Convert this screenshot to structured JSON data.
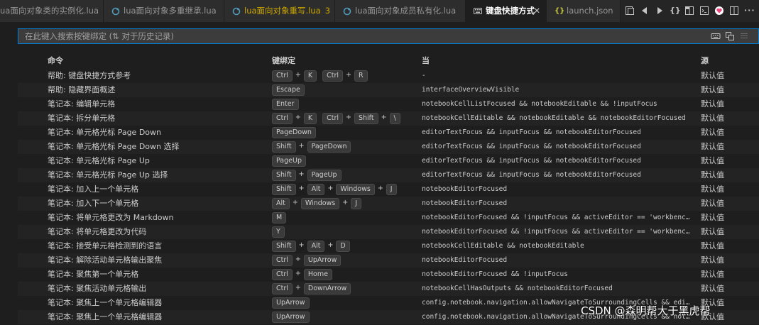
{
  "tabs": [
    {
      "label": "ua面向对象类的实例化.lua",
      "icon": "lua-file-icon",
      "state": "normal"
    },
    {
      "label": "lua面向对象多重继承.lua",
      "icon": "lua-file-icon",
      "state": "normal"
    },
    {
      "label": "lua面向对象重写.lua",
      "badge": "3",
      "icon": "lua-file-icon",
      "state": "modified"
    },
    {
      "label": "lua面向对象成员私有化.lua",
      "icon": "lua-file-icon",
      "state": "normal"
    },
    {
      "label": "键盘快捷方式",
      "icon": "keyboard-shortcuts-icon",
      "state": "active",
      "close": "✕"
    },
    {
      "label": "launch.json",
      "icon": "json-file-icon",
      "state": "normal"
    }
  ],
  "editor_actions": [
    "open-changes-icon",
    "go-back-icon",
    "go-forward-icon",
    "open-json-icon",
    "split-editor-icon",
    "terminal-icon",
    "extension-icon",
    "split-vertical-icon",
    "more-actions-icon"
  ],
  "search": {
    "placeholder": "在此键入搜索按键绑定 (⇅ 对于历史记录)",
    "icons": [
      "keyboard-record-icon",
      "sort-by-precedence-icon",
      "clear-filter-icon"
    ]
  },
  "table": {
    "headers": {
      "command": "命令",
      "keybinding": "键绑定",
      "when": "当",
      "source": "源"
    },
    "rows": [
      {
        "command": "帮助: 键盘快捷方式参考",
        "keys": [
          [
            "Ctrl",
            "K"
          ],
          [
            "Ctrl",
            "R"
          ]
        ],
        "when": "-",
        "source": "默认值"
      },
      {
        "command": "帮助: 隐藏界面概述",
        "keys": [
          [
            "Escape"
          ]
        ],
        "when": "interfaceOverviewVisible",
        "source": "默认值"
      },
      {
        "command": "笔记本: 编辑单元格",
        "keys": [
          [
            "Enter"
          ]
        ],
        "when": "notebookCellListFocused && notebookEditable && !inputFocus",
        "source": "默认值"
      },
      {
        "command": "笔记本: 拆分单元格",
        "keys": [
          [
            "Ctrl",
            "K"
          ],
          [
            "Ctrl",
            "Shift",
            "\\"
          ]
        ],
        "when": "notebookCellEditable && notebookEditable && notebookEditorFocused",
        "source": "默认值"
      },
      {
        "command": "笔记本: 单元格光标 Page Down",
        "keys": [
          [
            "PageDown"
          ]
        ],
        "when": "editorTextFocus && inputFocus && notebookEditorFocused",
        "source": "默认值"
      },
      {
        "command": "笔记本: 单元格光标 Page Down 选择",
        "keys": [
          [
            "Shift",
            "PageDown"
          ]
        ],
        "when": "editorTextFocus && inputFocus && notebookEditorFocused",
        "source": "默认值"
      },
      {
        "command": "笔记本: 单元格光标 Page Up",
        "keys": [
          [
            "PageUp"
          ]
        ],
        "when": "editorTextFocus && inputFocus && notebookEditorFocused",
        "source": "默认值"
      },
      {
        "command": "笔记本: 单元格光标 Page Up 选择",
        "keys": [
          [
            "Shift",
            "PageUp"
          ]
        ],
        "when": "editorTextFocus && inputFocus && notebookEditorFocused",
        "source": "默认值"
      },
      {
        "command": "笔记本: 加入上一个单元格",
        "keys": [
          [
            "Shift",
            "Alt",
            "Windows",
            "J"
          ]
        ],
        "when": "notebookEditorFocused",
        "source": "默认值"
      },
      {
        "command": "笔记本: 加入下一个单元格",
        "keys": [
          [
            "Alt",
            "Windows",
            "J"
          ]
        ],
        "when": "notebookEditorFocused",
        "source": "默认值"
      },
      {
        "command": "笔记本: 将单元格更改为 Markdown",
        "keys": [
          [
            "M"
          ]
        ],
        "when": "notebookEditorFocused && !inputFocus && activeEditor == 'workbench.edi…",
        "source": "默认值"
      },
      {
        "command": "笔记本: 将单元格更改为代码",
        "keys": [
          [
            "Y"
          ]
        ],
        "when": "notebookEditorFocused && !inputFocus && activeEditor == 'workbench.edi…",
        "source": "默认值"
      },
      {
        "command": "笔记本: 接受单元格检测到的语言",
        "keys": [
          [
            "Shift",
            "Alt",
            "D"
          ]
        ],
        "when": "notebookCellEditable && notebookEditable",
        "source": "默认值"
      },
      {
        "command": "笔记本: 解除活动单元格输出聚焦",
        "keys": [
          [
            "Ctrl",
            "UpArrow"
          ]
        ],
        "when": "notebookEditorFocused",
        "source": "默认值"
      },
      {
        "command": "笔记本: 聚焦第一个单元格",
        "keys": [
          [
            "Ctrl",
            "Home"
          ]
        ],
        "when": "notebookEditorFocused && !inputFocus",
        "source": "默认值"
      },
      {
        "command": "笔记本: 聚焦活动单元格输出",
        "keys": [
          [
            "Ctrl",
            "DownArrow"
          ]
        ],
        "when": "notebookCellHasOutputs && notebookEditorFocused",
        "source": "默认值"
      },
      {
        "command": "笔记本: 聚焦上一个单元格编辑器",
        "keys": [
          [
            "UpArrow"
          ]
        ],
        "when": "config.notebook.navigation.allowNavigateToSurroundingCells && editorTe…",
        "source": "默认值"
      },
      {
        "command": "笔记本: 聚焦上一个单元格编辑器",
        "keys": [
          [
            "UpArrow"
          ]
        ],
        "when": "config.notebook.navigation.allowNavigateToSurroundingCells && notebook…",
        "source": "默认值"
      }
    ]
  },
  "watermark": "CSDN @森明帮大于黑虎帮"
}
